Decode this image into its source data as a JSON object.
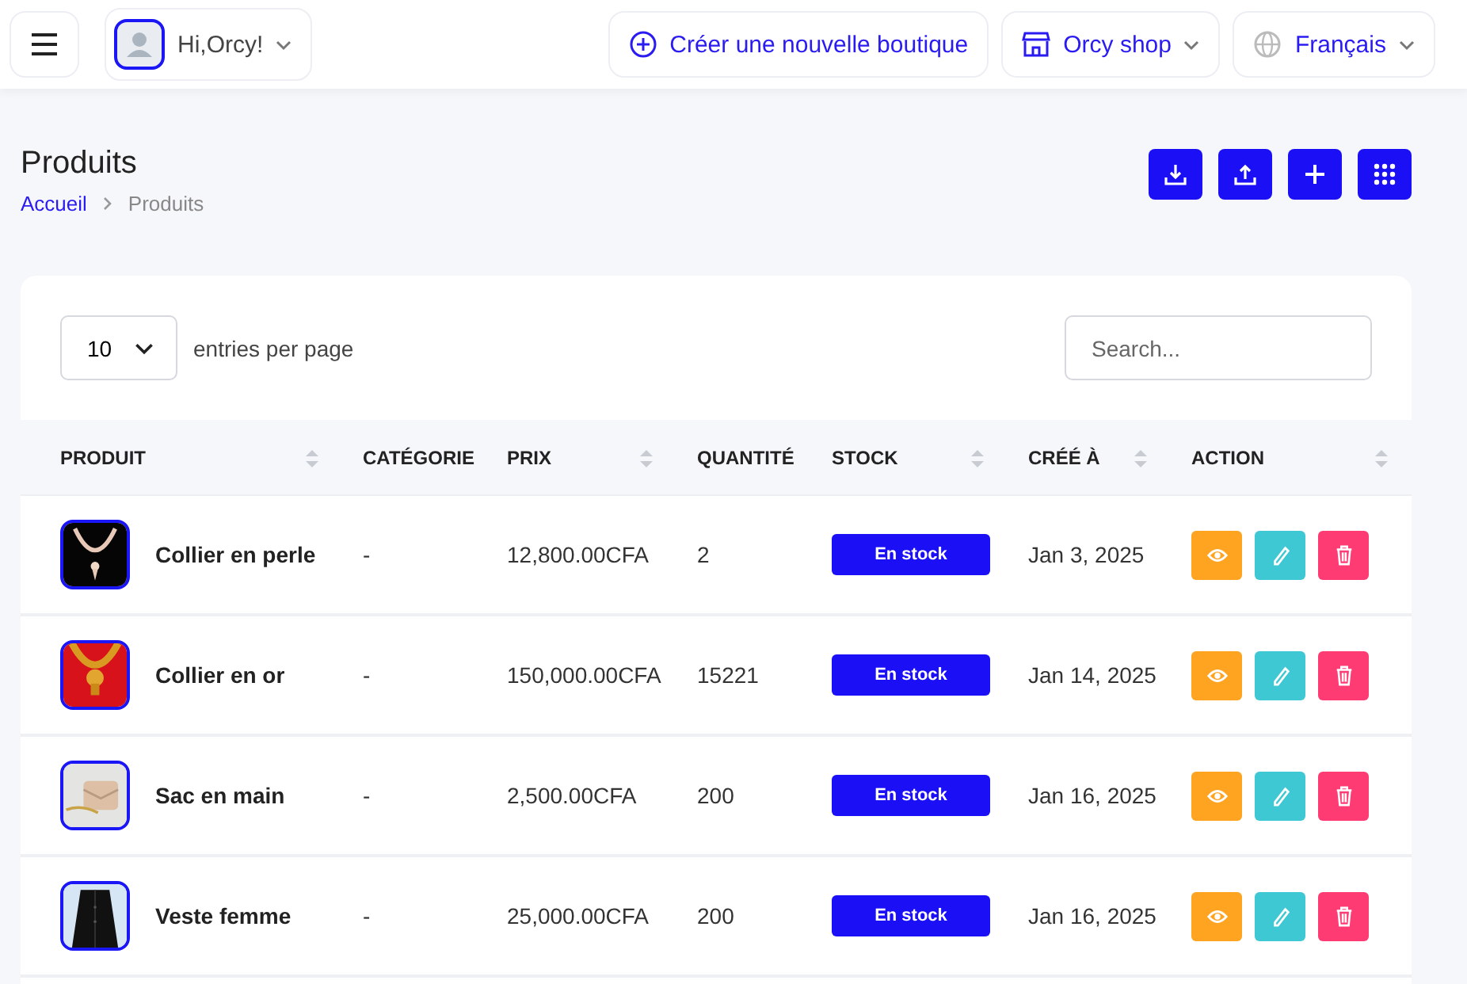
{
  "topbar": {
    "user_greeting": "Hi,Orcy!",
    "create_button": "Créer une nouvelle boutique",
    "shop_menu": "Orcy shop",
    "language_menu": "Français"
  },
  "page": {
    "title": "Produits",
    "breadcrumb": [
      {
        "label": "Accueil",
        "selected": false
      },
      {
        "label": "Produits",
        "selected": true
      }
    ]
  },
  "table_controls": {
    "page_size": "10",
    "page_size_label": "entries per page",
    "search": {
      "placeholder": "Search..."
    }
  },
  "table": {
    "columns": [
      "PRODUIT",
      "CATÉGORIE",
      "PRIX",
      "QUANTITÉ",
      "STOCK",
      "CRÉÉ À",
      "ACTION"
    ],
    "rows": [
      {
        "name": "Collier en perle",
        "category": "-",
        "price": "12,800.00CFA",
        "quantity": "2",
        "stock": "En stock",
        "created": "Jan 3, 2025"
      },
      {
        "name": "Collier en or",
        "category": "-",
        "price": "150,000.00CFA",
        "quantity": "15221",
        "stock": "En stock",
        "created": "Jan 14, 2025"
      },
      {
        "name": "Sac en main",
        "category": "-",
        "price": "2,500.00CFA",
        "quantity": "200",
        "stock": "En stock",
        "created": "Jan 16, 2025"
      },
      {
        "name": "Veste femme",
        "category": "-",
        "price": "25,000.00CFA",
        "quantity": "200",
        "stock": "En stock",
        "created": "Jan 16, 2025"
      }
    ]
  }
}
